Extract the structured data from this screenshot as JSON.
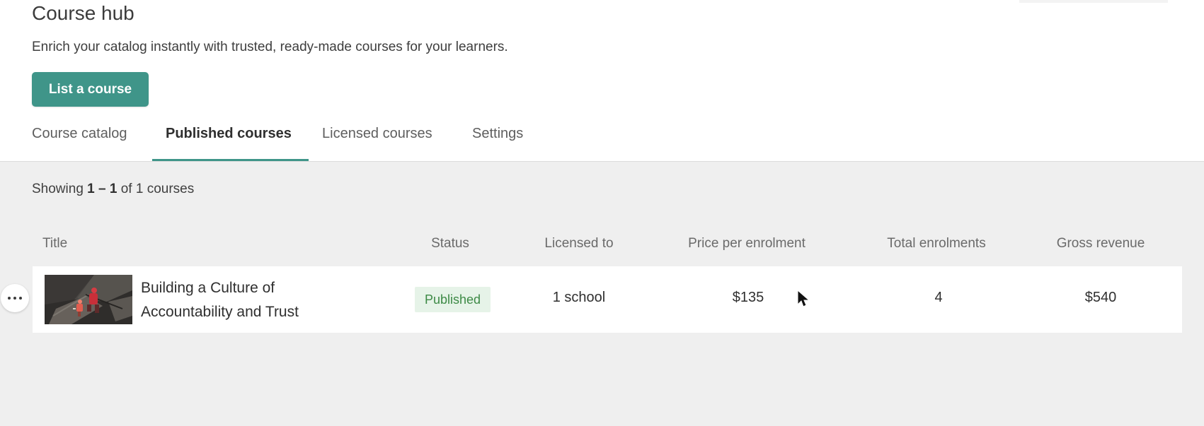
{
  "page": {
    "title": "Course hub",
    "subtitle": "Enrich your catalog instantly with trusted, ready-made courses for your learners."
  },
  "actions": {
    "list_course_label": "List a course"
  },
  "tabs": [
    {
      "label": "Course catalog",
      "active": false
    },
    {
      "label": "Published courses",
      "active": true
    },
    {
      "label": "Licensed courses",
      "active": false
    },
    {
      "label": "Settings",
      "active": false
    }
  ],
  "results": {
    "prefix": "Showing",
    "range": "1 – 1",
    "middle": "of",
    "total": "1",
    "suffix": "courses"
  },
  "table": {
    "columns": [
      "Title",
      "Status",
      "Licensed to",
      "Price per enrolment",
      "Total enrolments",
      "Gross revenue"
    ],
    "rows": [
      {
        "title": "Building a Culture of Accountability and Trust",
        "status": "Published",
        "licensed_to": "1 school",
        "price": "$135",
        "total_enrolments": "4",
        "gross_revenue": "$540"
      }
    ]
  },
  "icons": {
    "more": "more-horizontal-icon",
    "cursor": "mouse-pointer-icon"
  },
  "colors": {
    "accent": "#3f9589",
    "published_bg": "#e6f3e8",
    "published_text": "#3d8a46",
    "panel_bg": "#efefef"
  }
}
